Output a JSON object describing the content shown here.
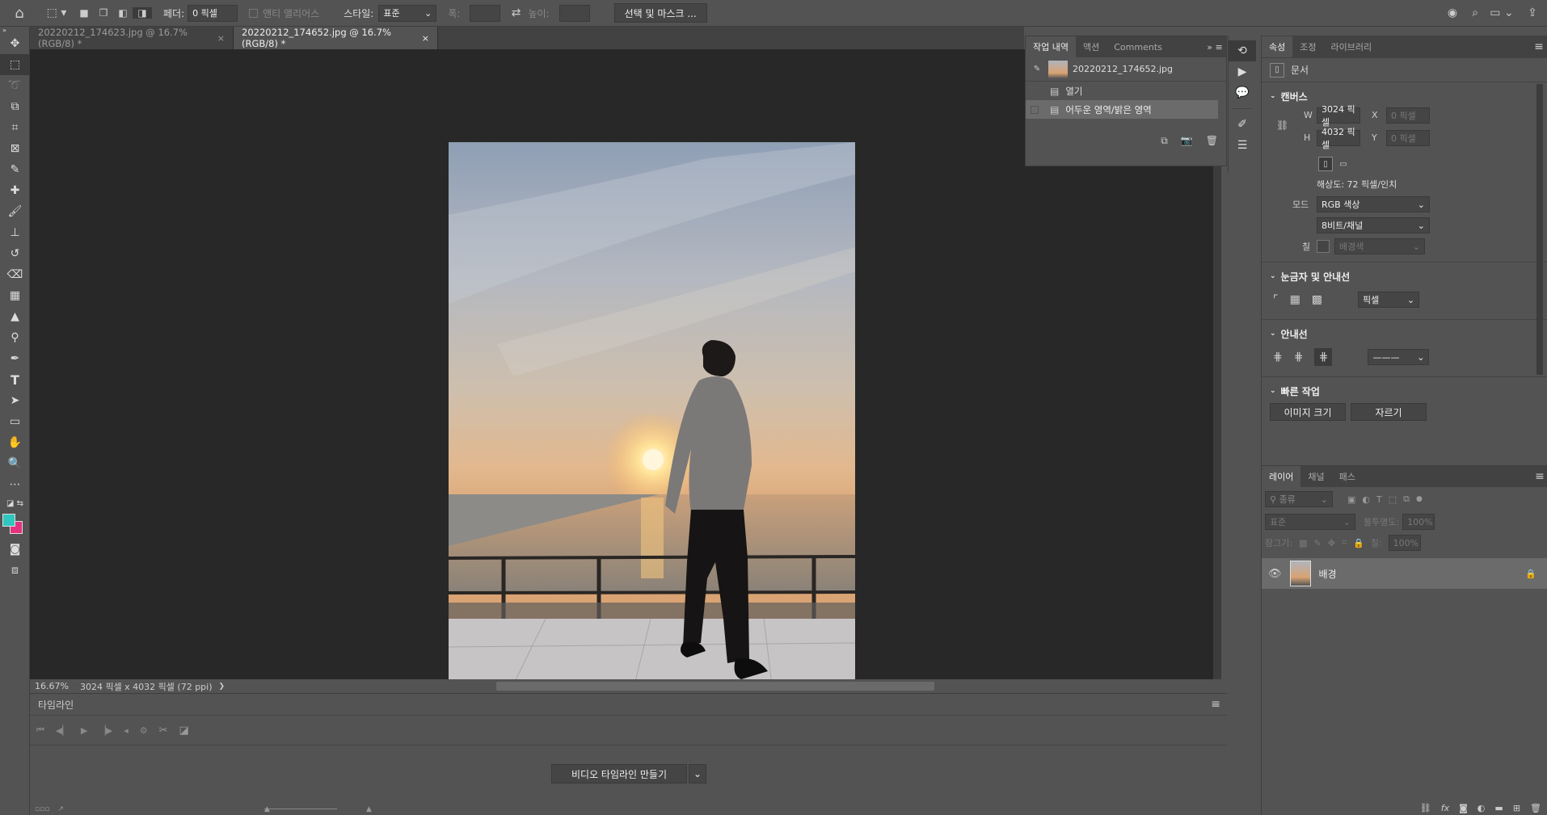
{
  "options_bar": {
    "feather_label": "페더:",
    "feather_value": "0 픽셀",
    "anti_alias_label": "앤티 앨리어스",
    "style_label": "스타일:",
    "style_value": "표준",
    "width_label": "폭:",
    "height_label": "높이:",
    "select_mask_label": "선택 및 마스크 ..."
  },
  "tabs": [
    {
      "label": "20220212_174623.jpg @ 16.7% (RGB/8) *",
      "close": "×"
    },
    {
      "label": "20220212_174652.jpg @ 16.7% (RGB/8) *",
      "close": "×"
    }
  ],
  "status": {
    "zoom": "16.67%",
    "doc_info": "3024 픽셀 x 4032 픽셀 (72 ppi)",
    "arrow": "❯"
  },
  "timeline": {
    "title": "타임라인",
    "create_button": "비디오 타임라인 만들기"
  },
  "history": {
    "tabs": [
      "작업 내역",
      "액션",
      "Comments"
    ],
    "snapshot": "20220212_174652.jpg",
    "items": [
      "열기",
      "어두운 영역/밝은 영역"
    ]
  },
  "properties": {
    "tabs": [
      "속성",
      "조정",
      "라이브러리"
    ],
    "doc_label": "문서",
    "canvas_title": "캔버스",
    "w_label": "W",
    "w_value": "3024 픽셀",
    "h_label": "H",
    "h_value": "4032 픽셀",
    "x_label": "X",
    "x_placeholder": "0 픽셀",
    "y_label": "Y",
    "y_placeholder": "0 픽셀",
    "resolution": "해상도: 72 픽셀/인치",
    "mode_label": "모드",
    "mode_value": "RGB 색상",
    "depth_value": "8비트/채널",
    "fill_label": "칠",
    "fill_value": "배경색",
    "rulers_title": "눈금자 및 안내선",
    "rulers_unit": "픽셀",
    "guides_title": "안내선",
    "quick_title": "빠른 작업",
    "image_size_btn": "이미지 크기",
    "crop_btn": "자르기"
  },
  "layers": {
    "tabs": [
      "레이어",
      "채널",
      "패스"
    ],
    "filter_placeholder": "종류",
    "blend_mode": "표준",
    "opacity_label": "불투명도:",
    "opacity_value": "100%",
    "lock_label": "잠그기:",
    "fill_label": "칠:",
    "fill_value": "100%",
    "layer_name": "배경"
  },
  "colors": {
    "foreground": "#2fc7c0",
    "background": "#e3327f"
  }
}
